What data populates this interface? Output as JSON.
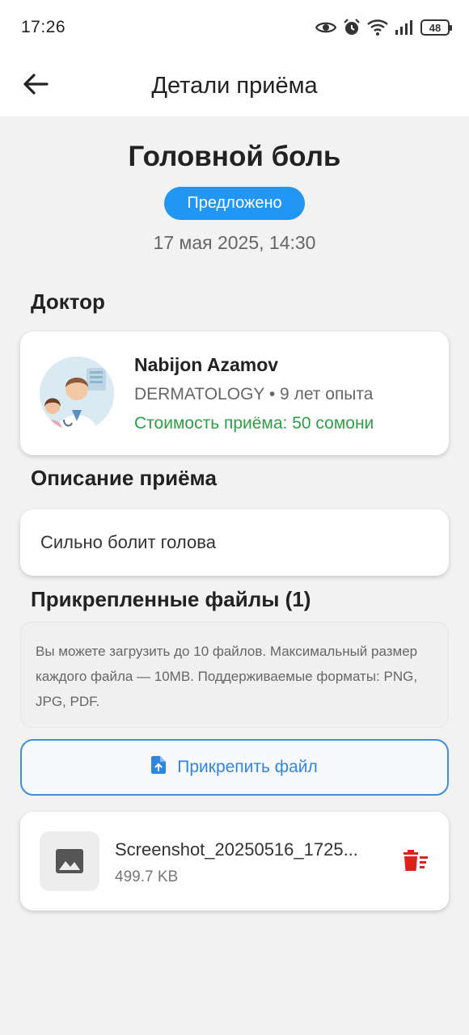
{
  "status_bar": {
    "time": "17:26",
    "battery": "48",
    "icons": [
      "eye-icon",
      "alarm-icon",
      "wifi-icon",
      "signal-icon",
      "battery-icon"
    ]
  },
  "app_bar": {
    "title": "Детали приёма",
    "back_icon": "arrow-left-icon"
  },
  "appointment": {
    "title": "Головной боль",
    "status": "Предложено",
    "status_color": "#2196f3",
    "datetime": "17 мая 2025, 14:30"
  },
  "doctor_section": {
    "title": "Доктор",
    "name": "Nabijon Azamov",
    "meta": "DERMATOLOGY • 9 лет опыта",
    "price": "Стоимость приёма: 50 сомони",
    "price_color": "#2e9e44"
  },
  "description_section": {
    "title": "Описание приёма",
    "text": "Сильно болит голова"
  },
  "files_section": {
    "title": "Прикрепленные файлы (1)",
    "info": "Вы можете загрузить до 10 файлов. Максимальный размер каждого файла — 10MB. Поддерживаемые форматы: PNG, JPG, PDF.",
    "attach_label": "Прикрепить файл",
    "accent_color": "#2f86e0",
    "files": [
      {
        "name": "Screenshot_20250516_1725...",
        "size": "499.7 KB",
        "icon": "image-icon"
      }
    ]
  }
}
